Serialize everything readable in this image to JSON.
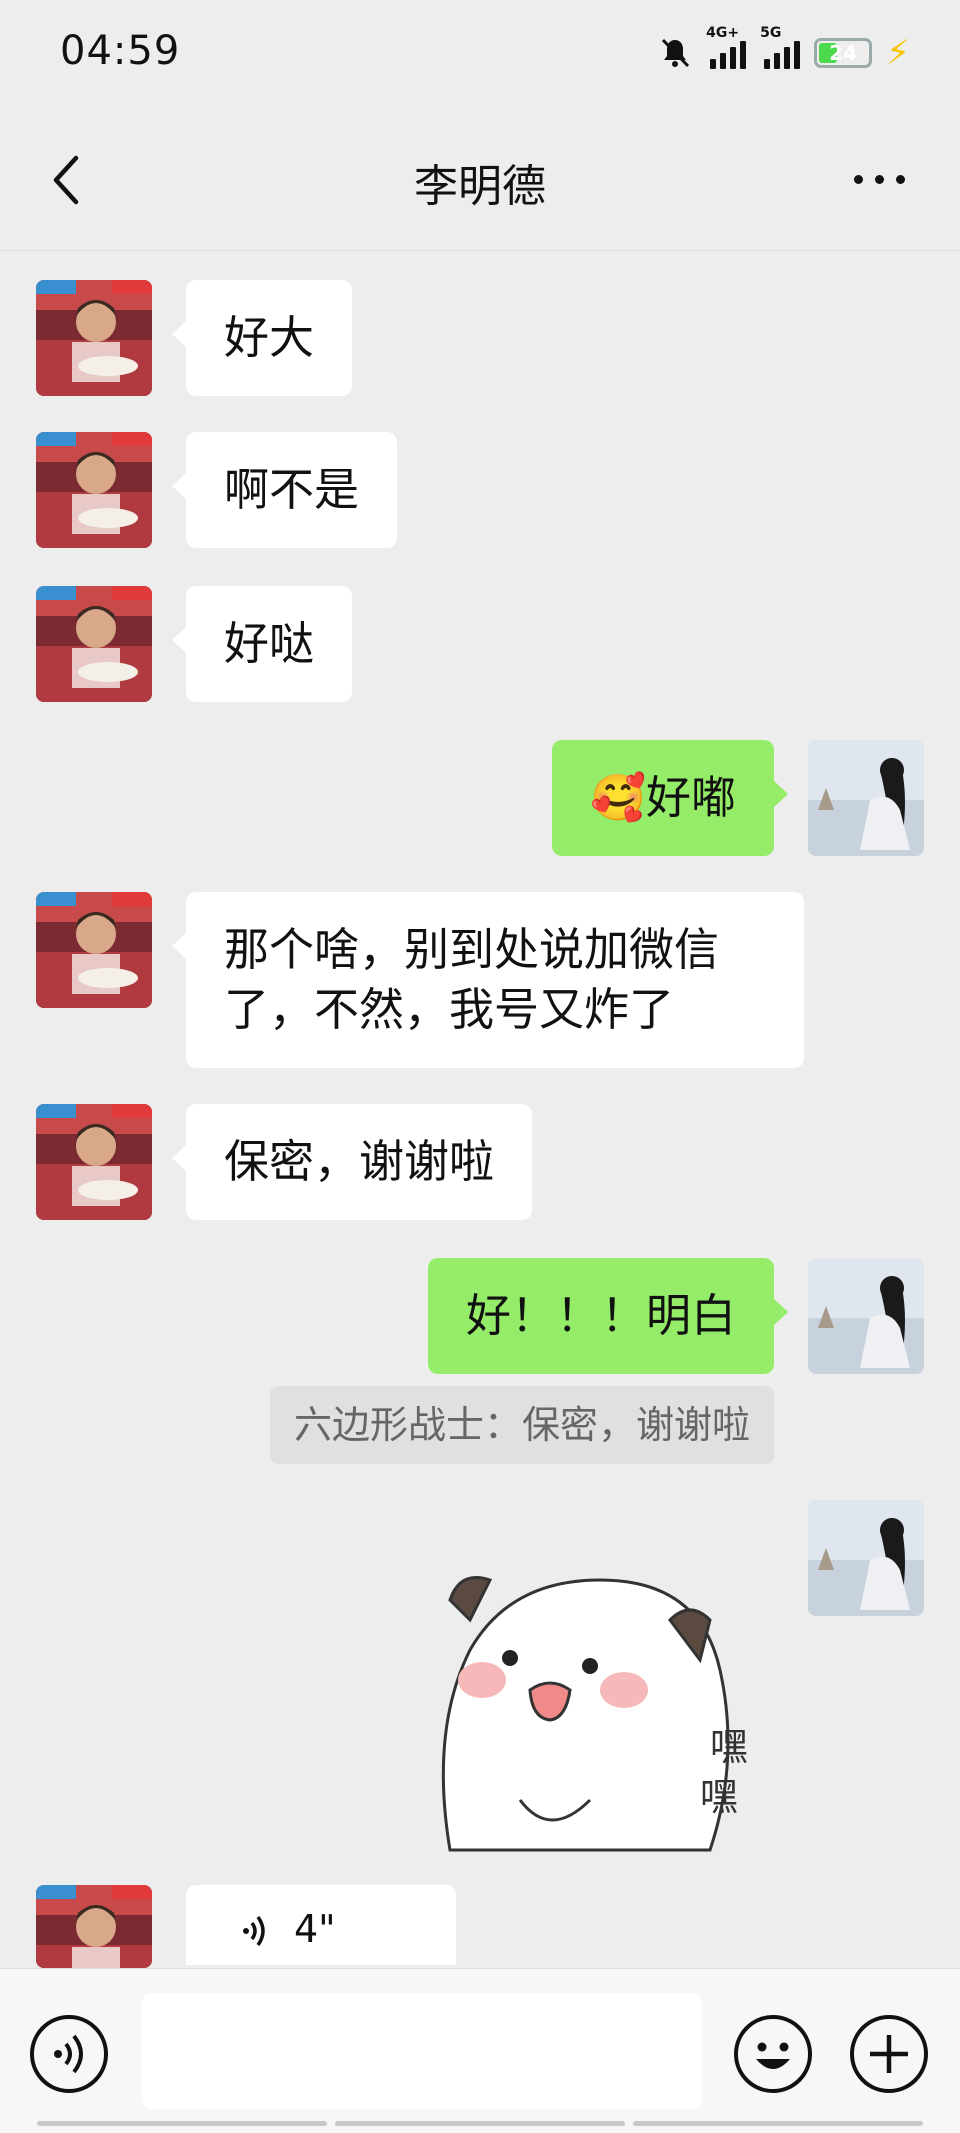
{
  "status_bar": {
    "time": "04:59",
    "network_1": "4G+",
    "network_2": "5G",
    "battery": "24"
  },
  "header": {
    "title": "李明德"
  },
  "messages": [
    {
      "side": "left",
      "text": "好大"
    },
    {
      "side": "left",
      "text": "啊不是"
    },
    {
      "side": "left",
      "text": "好哒"
    },
    {
      "side": "right",
      "emoji": "🥰",
      "text": "好嘟"
    },
    {
      "side": "left",
      "text": "那个啥，别到处说加微信了，不然，我号又炸了",
      "line1": "那个啥，别到处说加微信",
      "line2": "了，不然，我号又炸了"
    },
    {
      "side": "left",
      "text": "保密，谢谢啦"
    },
    {
      "side": "right",
      "text": "好！！！明白"
    },
    {
      "side": "right",
      "type": "sticker",
      "sticker_text_1": "嘿",
      "sticker_text_2": "嘿"
    },
    {
      "side": "left",
      "type": "voice",
      "duration": "4\""
    }
  ],
  "quote": "六边形战士：保密，谢谢啦",
  "colors": {
    "background": "#ededed",
    "sent_bubble": "#95ec69",
    "received_bubble": "#ffffff",
    "quote_bg": "#e0e0e0"
  },
  "icons": {
    "back": "chevron-left-icon",
    "more": "more-dots-icon",
    "voice_input": "voice-icon",
    "emoji": "emoji-icon",
    "plus": "plus-icon"
  }
}
